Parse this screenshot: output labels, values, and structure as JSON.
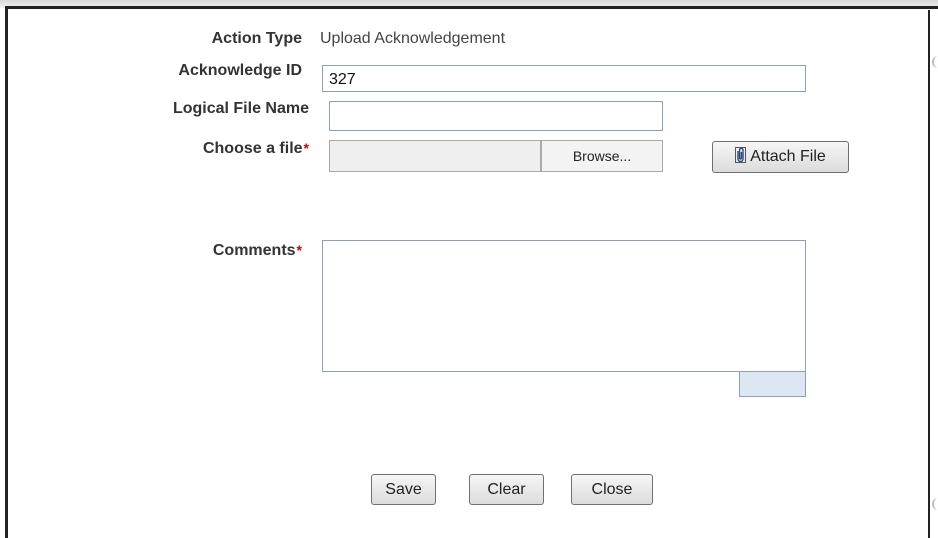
{
  "form": {
    "action_type": {
      "label": "Action Type",
      "value": "Upload Acknowledgement"
    },
    "acknowledge_id": {
      "label": "Acknowledge ID",
      "value": "327"
    },
    "logical_file_name": {
      "label": "Logical File Name",
      "value": ""
    },
    "choose_file": {
      "label": "Choose a file",
      "required_mark": "*",
      "browse_label": "Browse..."
    },
    "attach_file": {
      "label": "Attach File",
      "icon": "paperclip-icon"
    },
    "comments": {
      "label": "Comments",
      "required_mark": "*",
      "value": ""
    }
  },
  "actions": {
    "save_label": "Save",
    "clear_label": "Clear",
    "close_label": "Close"
  },
  "colors": {
    "required": "#cc0000",
    "input_border": "#8aa0b4",
    "resize_handle": "#dde7f3"
  }
}
